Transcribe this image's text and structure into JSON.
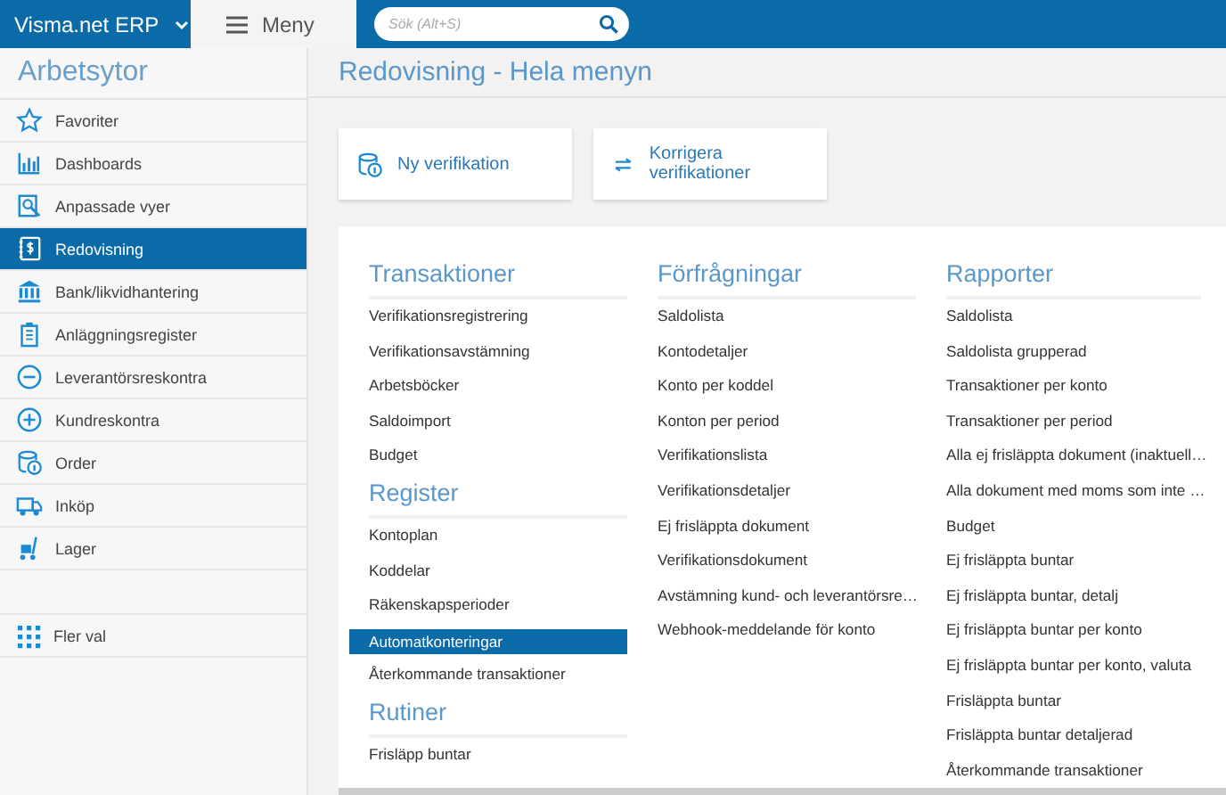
{
  "topbar": {
    "brand": "Visma.net ERP",
    "menu_tab": {
      "label": "Meny",
      "selected": true
    },
    "search": {
      "placeholder": "Sök (Alt+S)"
    }
  },
  "sidebar": {
    "title": "Arbetsytor",
    "items": [
      {
        "label": "Favoriter",
        "selected": false
      },
      {
        "label": "Dashboards",
        "selected": false
      },
      {
        "label": "Anpassade vyer",
        "selected": false
      },
      {
        "label": "Redovisning",
        "selected": true
      },
      {
        "label": "Bank/likvidhantering",
        "selected": false
      },
      {
        "label": "Anläggningsregister",
        "selected": false
      },
      {
        "label": "Leverantörsreskontra",
        "selected": false
      },
      {
        "label": "Kundreskontra",
        "selected": false
      },
      {
        "label": "Order",
        "selected": false
      },
      {
        "label": "Inköp",
        "selected": false
      },
      {
        "label": "Lager",
        "selected": false
      }
    ],
    "more": "Fler val"
  },
  "main": {
    "title": "Redovisning - Hela menyn",
    "quick_actions": [
      {
        "label": "Ny verifikation"
      },
      {
        "label": "Korrigera verifikationer"
      }
    ],
    "columns": [
      {
        "sections": [
          {
            "heading": "Transaktioner",
            "items": [
              {
                "label": "Verifikationsregistrering",
                "selected": false
              },
              {
                "label": "Verifikationsavstämning",
                "selected": false
              },
              {
                "label": "Arbetsböcker",
                "selected": false
              },
              {
                "label": "Saldoimport",
                "selected": false
              },
              {
                "label": "Budget",
                "selected": false
              }
            ]
          },
          {
            "heading": "Register",
            "items": [
              {
                "label": "Kontoplan",
                "selected": false
              },
              {
                "label": "Koddelar",
                "selected": false
              },
              {
                "label": "Räkenskapsperioder",
                "selected": false
              },
              {
                "label": "Automatkonteringar",
                "selected": true
              },
              {
                "label": "Återkommande transaktioner",
                "selected": false
              }
            ]
          },
          {
            "heading": "Rutiner",
            "items": [
              {
                "label": "Frisläpp buntar",
                "selected": false
              }
            ]
          }
        ]
      },
      {
        "sections": [
          {
            "heading": "Förfrågningar",
            "items": [
              {
                "label": "Saldolista",
                "selected": false
              },
              {
                "label": "Kontodetaljer",
                "selected": false
              },
              {
                "label": "Konto per koddel",
                "selected": false
              },
              {
                "label": "Konton per period",
                "selected": false
              },
              {
                "label": "Verifikationslista",
                "selected": false
              },
              {
                "label": "Verifikationsdetaljer",
                "selected": false
              },
              {
                "label": "Ej frisläppta dokument",
                "selected": false
              },
              {
                "label": "Verifikationsdokument",
                "selected": false
              },
              {
                "label": "Avstämning kund- och leverantörsre…",
                "selected": false
              },
              {
                "label": "Webhook-meddelande för konto",
                "selected": false
              }
            ]
          }
        ]
      },
      {
        "sections": [
          {
            "heading": "Rapporter",
            "items": [
              {
                "label": "Saldolista",
                "selected": false
              },
              {
                "label": "Saldolista grupperad",
                "selected": false
              },
              {
                "label": "Transaktioner per konto",
                "selected": false
              },
              {
                "label": "Transaktioner per period",
                "selected": false
              },
              {
                "label": "Alla ej frisläppta dokument (inaktuell…",
                "selected": false
              },
              {
                "label": "Alla dokument med moms som inte …",
                "selected": false
              },
              {
                "label": "Budget",
                "selected": false
              },
              {
                "label": "Ej frisläppta buntar",
                "selected": false
              },
              {
                "label": "Ej frisläppta buntar, detalj",
                "selected": false
              },
              {
                "label": "Ej frisläppta buntar per konto",
                "selected": false
              },
              {
                "label": "Ej frisläppta buntar per konto, valuta",
                "selected": false
              },
              {
                "label": "Frisläppta buntar",
                "selected": false
              },
              {
                "label": "Frisläppta buntar detaljerad",
                "selected": false
              },
              {
                "label": "Återkommande transaktioner",
                "selected": false
              }
            ]
          }
        ]
      }
    ]
  }
}
